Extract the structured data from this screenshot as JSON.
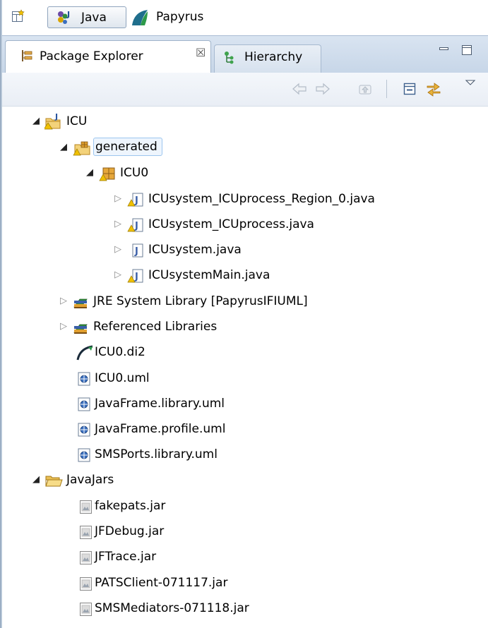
{
  "perspectives": {
    "java_label": "Java",
    "papyrus_label": "Papyrus"
  },
  "view": {
    "active_tab": "Package Explorer",
    "close_glyph": "☒",
    "inactive_tab": "Hierarchy"
  },
  "tree": {
    "projects": [
      {
        "label": "ICU",
        "source_folder": "generated",
        "package": "ICU0",
        "java_files": [
          "ICUsystem_ICUprocess_Region_0.java",
          "ICUsystem_ICUprocess.java",
          "ICUsystem.java",
          "ICUsystemMain.java"
        ],
        "libraries": [
          "JRE System Library [PapyrusIFIUML]",
          "Referenced Libraries"
        ],
        "di_file": "ICU0.di2",
        "uml_files": [
          "ICU0.uml",
          "JavaFrame.library.uml",
          "JavaFrame.profile.uml",
          "SMSPorts.library.uml"
        ]
      },
      {
        "label": "JavaJars",
        "jars": [
          "fakepats.jar",
          "JFDebug.jar",
          "JFTrace.jar",
          "PATSClient-071117.jar",
          "SMSMediators-071118.jar"
        ]
      }
    ]
  },
  "colors": {
    "selection_fill": "#eef5fd",
    "selection_border": "#9cc6ef",
    "tab_gradient_top": "#d9e4f1",
    "tab_gradient_bottom": "#c7d6e8",
    "package_icon": "#c98a1a",
    "java_file_icon": "#3a5fa8",
    "warning_badge": "#e8b400",
    "library_icon_green": "#2e8b3a"
  }
}
